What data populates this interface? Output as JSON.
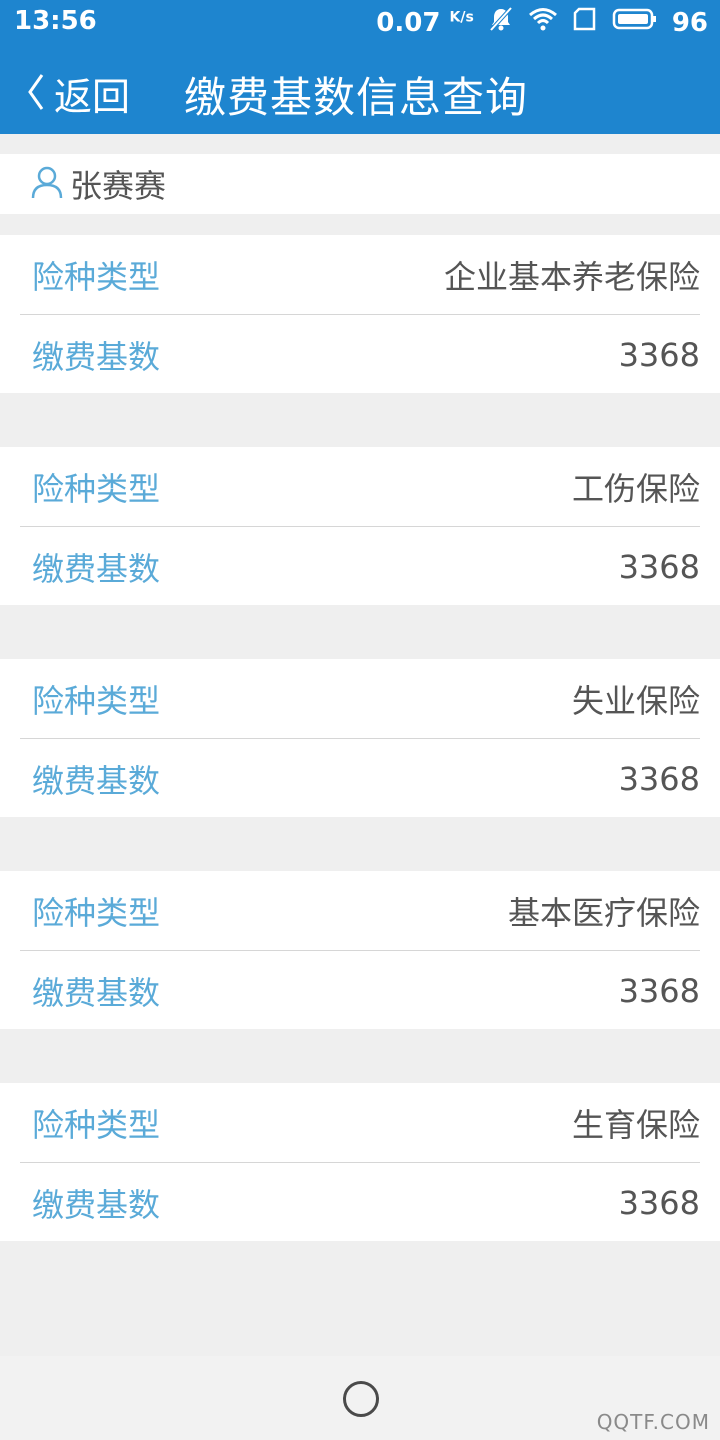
{
  "status_bar": {
    "time": "13:56",
    "speed": "0.07",
    "speed_unit": "K/s",
    "battery": "96",
    "icons": [
      "mute-icon",
      "wifi-icon",
      "sim-icon",
      "battery-icon"
    ]
  },
  "header": {
    "back_label": "返回",
    "title": "缴费基数信息查询"
  },
  "user": {
    "name": "张赛赛"
  },
  "records": [
    {
      "type_label": "险种类型",
      "type_value": "企业基本养老保险",
      "base_label": "缴费基数",
      "base_value": "3368"
    },
    {
      "type_label": "险种类型",
      "type_value": "工伤保险",
      "base_label": "缴费基数",
      "base_value": "3368"
    },
    {
      "type_label": "险种类型",
      "type_value": "失业保险",
      "base_label": "缴费基数",
      "base_value": "3368"
    },
    {
      "type_label": "险种类型",
      "type_value": "基本医疗保险",
      "base_label": "缴费基数",
      "base_value": "3368"
    },
    {
      "type_label": "险种类型",
      "type_value": "生育保险",
      "base_label": "缴费基数",
      "base_value": "3368"
    }
  ],
  "watermark": "QQTF.COM",
  "colors": {
    "header_bg": "#1e85cf",
    "label_color": "#5aaad8",
    "value_color": "#555555",
    "page_bg": "#efefef"
  }
}
